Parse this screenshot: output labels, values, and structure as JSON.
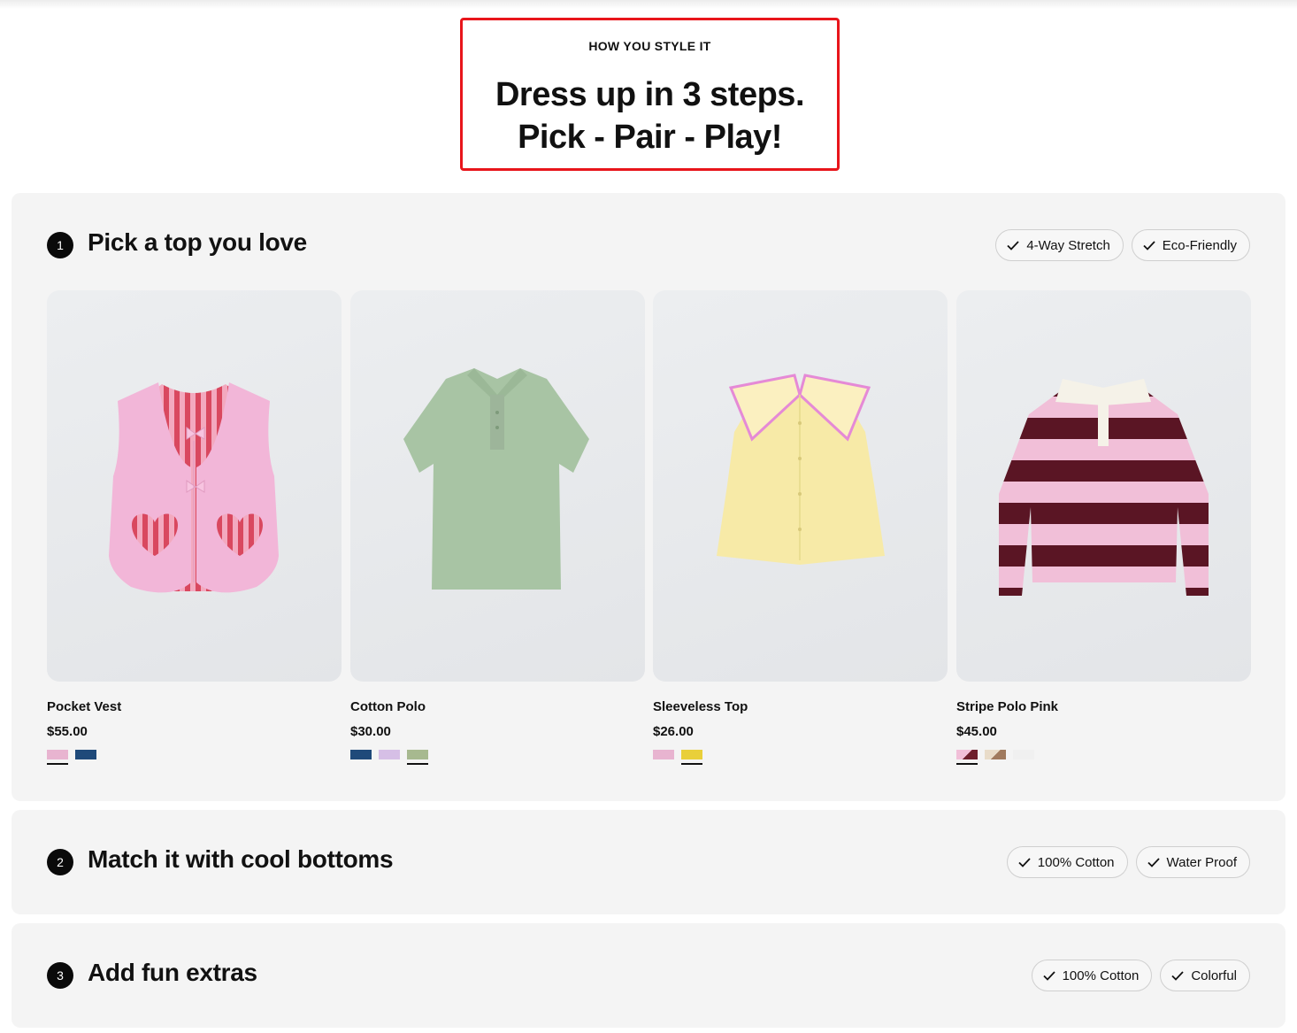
{
  "header": {
    "eyebrow": "HOW YOU STYLE IT",
    "headline_line1": "Dress up in 3 steps.",
    "headline_line2": "Pick - Pair - Play!",
    "highlight_color": "#e8151b"
  },
  "steps": [
    {
      "number": "1",
      "title": "Pick a top you love",
      "chips": [
        "4-Way Stretch",
        "Eco-Friendly"
      ],
      "products": [
        {
          "name": "Pocket Vest",
          "price": "$55.00",
          "swatches": [
            {
              "color": "#e8b4d0",
              "selected": true
            },
            {
              "color": "#1f4a7a",
              "selected": false
            }
          ]
        },
        {
          "name": "Cotton Polo",
          "price": "$30.00",
          "swatches": [
            {
              "color": "#1f4a7a",
              "selected": false
            },
            {
              "color": "#d6bfe6",
              "selected": false
            },
            {
              "color": "#a7b98f",
              "selected": true
            }
          ]
        },
        {
          "name": "Sleeveless Top",
          "price": "$26.00",
          "swatches": [
            {
              "color": "#e8b4d0",
              "selected": false
            },
            {
              "color": "#e9cf3a",
              "selected": true
            }
          ]
        },
        {
          "name": "Stripe Polo Pink",
          "price": "$45.00",
          "swatches": [
            {
              "color": "#6e1f2c",
              "selected": true
            },
            {
              "color": "#a07a5e",
              "selected": false
            },
            {
              "color": "#f0f0f0",
              "selected": false
            }
          ]
        }
      ]
    },
    {
      "number": "2",
      "title": "Match it with cool bottoms",
      "chips": [
        "100% Cotton",
        "Water Proof"
      ]
    },
    {
      "number": "3",
      "title": "Add fun extras",
      "chips": [
        "100% Cotton",
        "Colorful"
      ]
    }
  ],
  "icons": {
    "chip": "check-icon"
  }
}
